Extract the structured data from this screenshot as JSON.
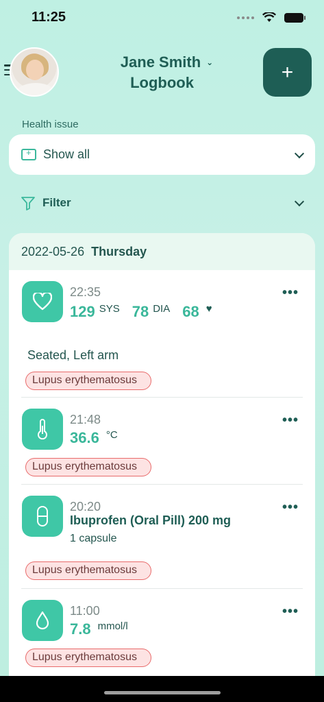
{
  "status_bar": {
    "time": "11:25",
    "icons": [
      "signal-icon",
      "wifi-icon",
      "battery-icon"
    ]
  },
  "header": {
    "name": "Jane Smith",
    "subtitle": "Logbook",
    "add_button_label": "+"
  },
  "health_issue": {
    "label": "Health issue",
    "selected": "Show all"
  },
  "filter": {
    "label": "Filter"
  },
  "day": {
    "date": "2022-05-26",
    "weekday": "Thursday"
  },
  "entries": [
    {
      "type": "blood-pressure",
      "time": "22:35",
      "sys": "129",
      "sys_unit": "SYS",
      "dia": "78",
      "dia_unit": "DIA",
      "pulse": "68",
      "position": "Seated,  Left arm",
      "tag": "Lupus erythematosus"
    },
    {
      "type": "temperature",
      "time": "21:48",
      "value": "36.6",
      "unit": "°C",
      "tag": "Lupus erythematosus"
    },
    {
      "type": "medication",
      "time": "20:20",
      "name": "Ibuprofen (Oral Pill) 200 mg",
      "dose": "1 capsule",
      "tag": "Lupus erythematosus"
    },
    {
      "type": "glucose",
      "time": "11:00",
      "value": "7.8",
      "unit": "mmol/l",
      "tag": "Lupus erythematosus"
    }
  ],
  "colors": {
    "accent": "#3fc7a6",
    "dark": "#1e5e55",
    "tag_bg": "#fde3e3",
    "tag_border": "#e86a6a"
  }
}
